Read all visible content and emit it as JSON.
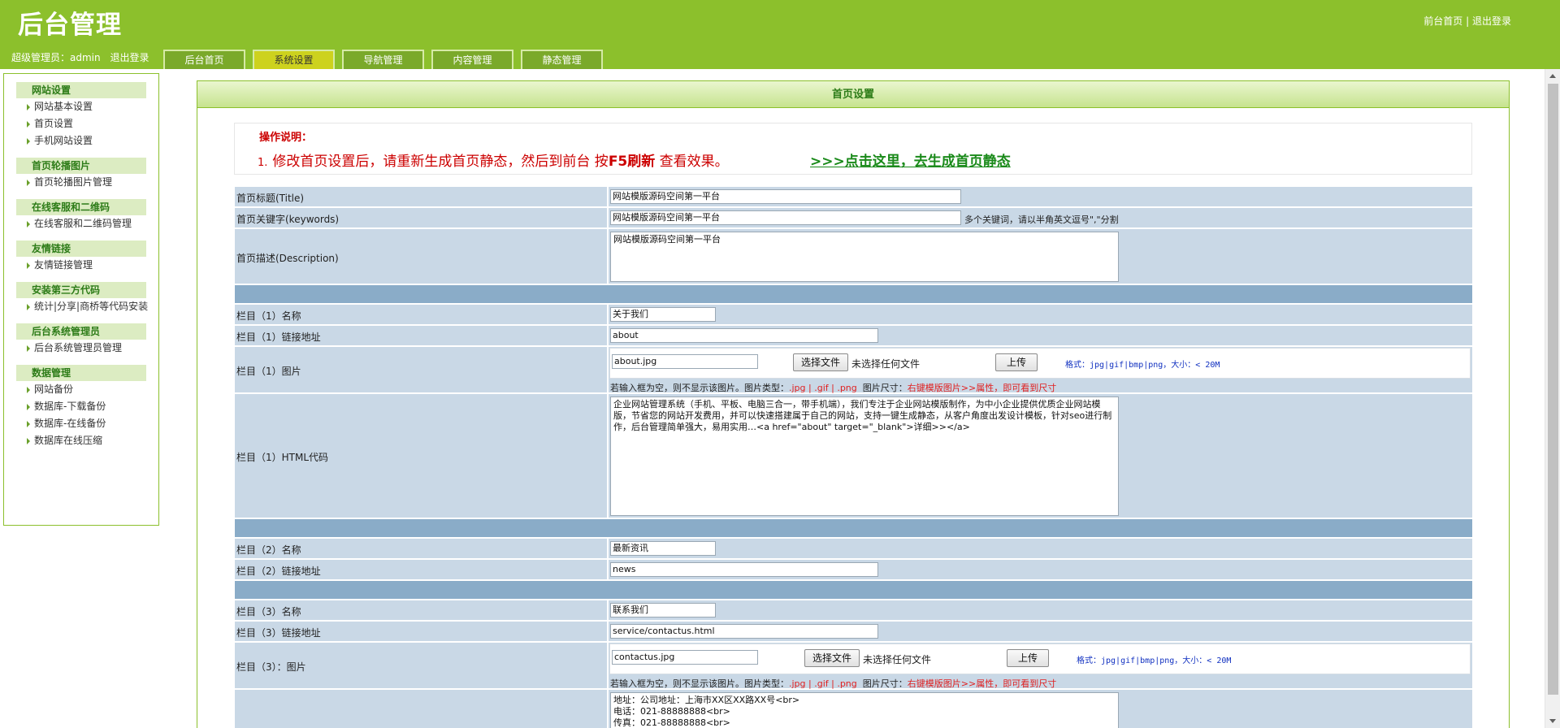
{
  "header": {
    "logo": "后台管理",
    "links": [
      "前台首页",
      "|",
      "退出登录"
    ],
    "user_label": "超级管理员：admin",
    "logout_label": "退出登录",
    "tabs": [
      "后台首页",
      "系统设置",
      "导航管理",
      "内容管理",
      "静态管理"
    ],
    "active_tab": "系统设置"
  },
  "sidebar": {
    "groups": [
      {
        "title": "网站设置",
        "items": [
          "网站基本设置",
          "首页设置",
          "手机网站设置"
        ]
      },
      {
        "title": "首页轮播图片",
        "items": [
          "首页轮播图片管理"
        ]
      },
      {
        "title": "在线客服和二维码",
        "items": [
          "在线客服和二维码管理"
        ]
      },
      {
        "title": "友情链接",
        "items": [
          "友情链接管理"
        ]
      },
      {
        "title": "安装第三方代码",
        "items": [
          "统计|分享|商桥等代码安装"
        ]
      },
      {
        "title": "后台系统管理员",
        "items": [
          "后台系统管理员管理"
        ]
      },
      {
        "title": "数据管理",
        "items": [
          "网站备份",
          "数据库-下载备份",
          "数据库-在线备份",
          "数据库在线压缩"
        ]
      }
    ]
  },
  "main": {
    "title": "首页设置",
    "notice_title": "操作说明：",
    "notice_num": "1.",
    "notice_text_a": "修改首页设置后，请重新生成首页静态，然后到前台 按",
    "notice_key": "F5刷新",
    "notice_text_b": " 查看效果。",
    "notice_link": ">>>点击这里，去生成首页静态"
  },
  "form": {
    "title_label": "首页标题(Title)",
    "title_value": "网站模版源码空间第一平台",
    "keywords_label": "首页关键字(keywords)",
    "keywords_value": "网站模版源码空间第一平台",
    "keywords_hint": "多个关键词，请以半角英文逗号\",\"分割",
    "desc_label": "首页描述(Description)",
    "desc_value": "网站模版源码空间第一平台",
    "c1_name_label": "栏目（1）名称",
    "c1_name_value": "关于我们",
    "c1_link_label": "栏目（1）链接地址",
    "c1_link_value": "about",
    "c1_img_label": "栏目（1）图片",
    "c1_img_value": "about.jpg",
    "choose_file": "选择文件",
    "no_file": "未选择任何文件",
    "upload": "上传",
    "format_hint": "格式：jpg|gif|bmp|png，大小：< 20M",
    "info_a": "若输入框为空，则不显示该图片。图片类型：",
    "info_types": ".jpg | .gif | .png",
    "info_b": "图片尺寸：",
    "info_c": "右键模版图片>>属性，即可看到尺寸",
    "c1_html_label": "栏目（1）HTML代码",
    "c1_html_value": "企业网站管理系统（手机、平板、电脑三合一，带手机端），我们专注于企业网站模版制作，为中小企业提供优质企业网站模版，节省您的网站开发费用，并可以快速搭建属于自己的网站，支持一键生成静态，从客户角度出发设计模板，针对seo进行制作，后台管理简单强大，易用实用…<a href=\"about\" target=\"_blank\">详细>></a>",
    "c2_name_label": "栏目（2）名称",
    "c2_name_value": "最新资讯",
    "c2_link_label": "栏目（2）链接地址",
    "c2_link_value": "news",
    "c3_name_label": "栏目（3）名称",
    "c3_name_value": "联系我们",
    "c3_link_label": "栏目（3）链接地址",
    "c3_link_value": "service/contactus.html",
    "c3_img_label": "栏目（3）：图片",
    "c3_img_value": "contactus.jpg",
    "c3_html_value": "地址：公司地址：上海市XX区XX路XX号<br>\n电话：021-88888888<br>\n传真：021-88888888<br>"
  }
}
